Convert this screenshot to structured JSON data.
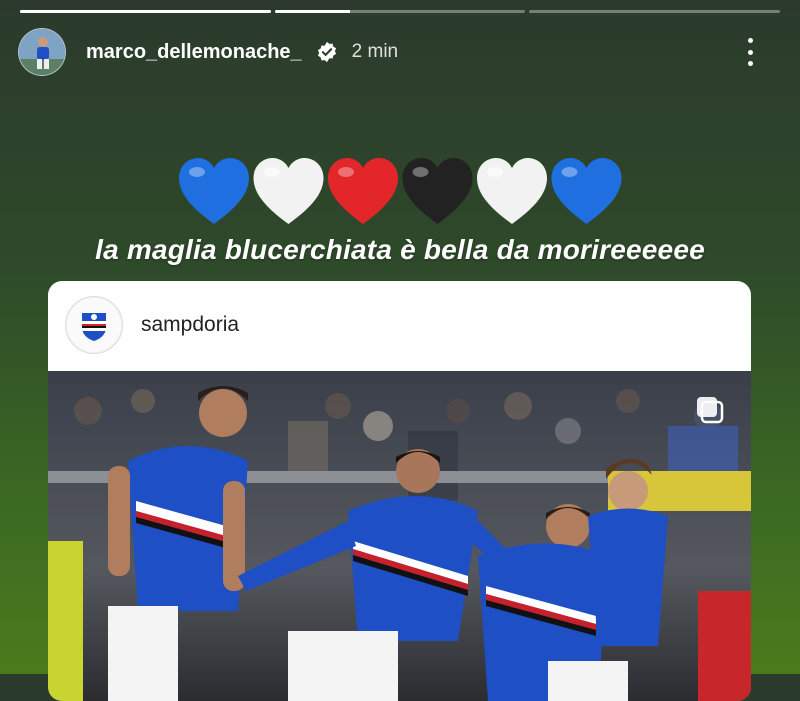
{
  "story": {
    "progress": [
      1,
      0.3,
      0
    ],
    "username": "marco_dellemonache_",
    "time": "2 min",
    "hearts": [
      "blue",
      "white",
      "red",
      "black",
      "white",
      "blue"
    ],
    "caption": "la maglia blucerchiata è bella da morireeeeee"
  },
  "post": {
    "account": "sampdoria"
  },
  "colors": {
    "heart_blue": "#1f6fe0",
    "heart_white": "#f2f2f2",
    "heart_red": "#e3262a",
    "heart_black": "#222222",
    "kit_blue": "#1e4fc4"
  }
}
